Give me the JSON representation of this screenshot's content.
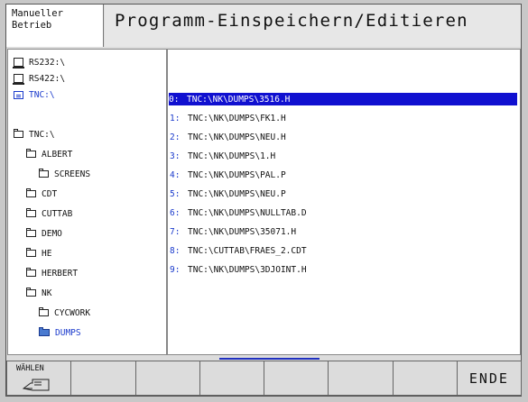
{
  "header": {
    "mode_line1": "Manueller",
    "mode_line2": "Betrieb",
    "title": "Programm-Einspeichern/Editieren"
  },
  "left_tree": [
    {
      "label": "RS232:\\",
      "icon": "drive-icon",
      "blue": false
    },
    {
      "label": "RS422:\\",
      "icon": "drive-icon",
      "blue": false
    },
    {
      "label": "TNC:\\",
      "icon": "tnc-drive-icon",
      "blue": true
    },
    {
      "label": "TNC:\\",
      "icon": "folder-icon",
      "blue": false
    },
    {
      "label": "ALBERT",
      "icon": "folder-icon",
      "blue": false
    },
    {
      "label": "SCREENS",
      "icon": "folder-icon",
      "blue": false
    },
    {
      "label": "CDT",
      "icon": "folder-icon",
      "blue": false
    },
    {
      "label": "CUTTAB",
      "icon": "folder-icon",
      "blue": false
    },
    {
      "label": "DEMO",
      "icon": "folder-icon",
      "blue": false
    },
    {
      "label": "HE",
      "icon": "folder-icon",
      "blue": false
    },
    {
      "label": "HERBERT",
      "icon": "folder-icon",
      "blue": false
    },
    {
      "label": "NK",
      "icon": "folder-icon",
      "blue": false
    },
    {
      "label": "CYCWORK",
      "icon": "folder-icon",
      "blue": false
    },
    {
      "label": "DUMPS",
      "icon": "folder-open-icon",
      "blue": true
    }
  ],
  "files": [
    {
      "num": "0:",
      "path": "TNC:\\NK\\DUMPS\\3516.H",
      "selected": true
    },
    {
      "num": "1:",
      "path": "TNC:\\NK\\DUMPS\\FK1.H",
      "selected": false
    },
    {
      "num": "2:",
      "path": "TNC:\\NK\\DUMPS\\NEU.H",
      "selected": false
    },
    {
      "num": "3:",
      "path": "TNC:\\NK\\DUMPS\\1.H",
      "selected": false
    },
    {
      "num": "4:",
      "path": "TNC:\\NK\\DUMPS\\PAL.P",
      "selected": false
    },
    {
      "num": "5:",
      "path": "TNC:\\NK\\DUMPS\\NEU.P",
      "selected": false
    },
    {
      "num": "6:",
      "path": "TNC:\\NK\\DUMPS\\NULLTAB.D",
      "selected": false
    },
    {
      "num": "7:",
      "path": "TNC:\\NK\\DUMPS\\35071.H",
      "selected": false
    },
    {
      "num": "8:",
      "path": "TNC:\\CUTTAB\\FRAES_2.CDT",
      "selected": false
    },
    {
      "num": "9:",
      "path": "TNC:\\NK\\DUMPS\\3DJOINT.H",
      "selected": false
    }
  ],
  "softkeys": {
    "waehlen_label": "WÄHLEN",
    "ende_label": "ENDE"
  },
  "colors": {
    "selection": "#1010d0",
    "accent_blue": "#1a3acc"
  }
}
